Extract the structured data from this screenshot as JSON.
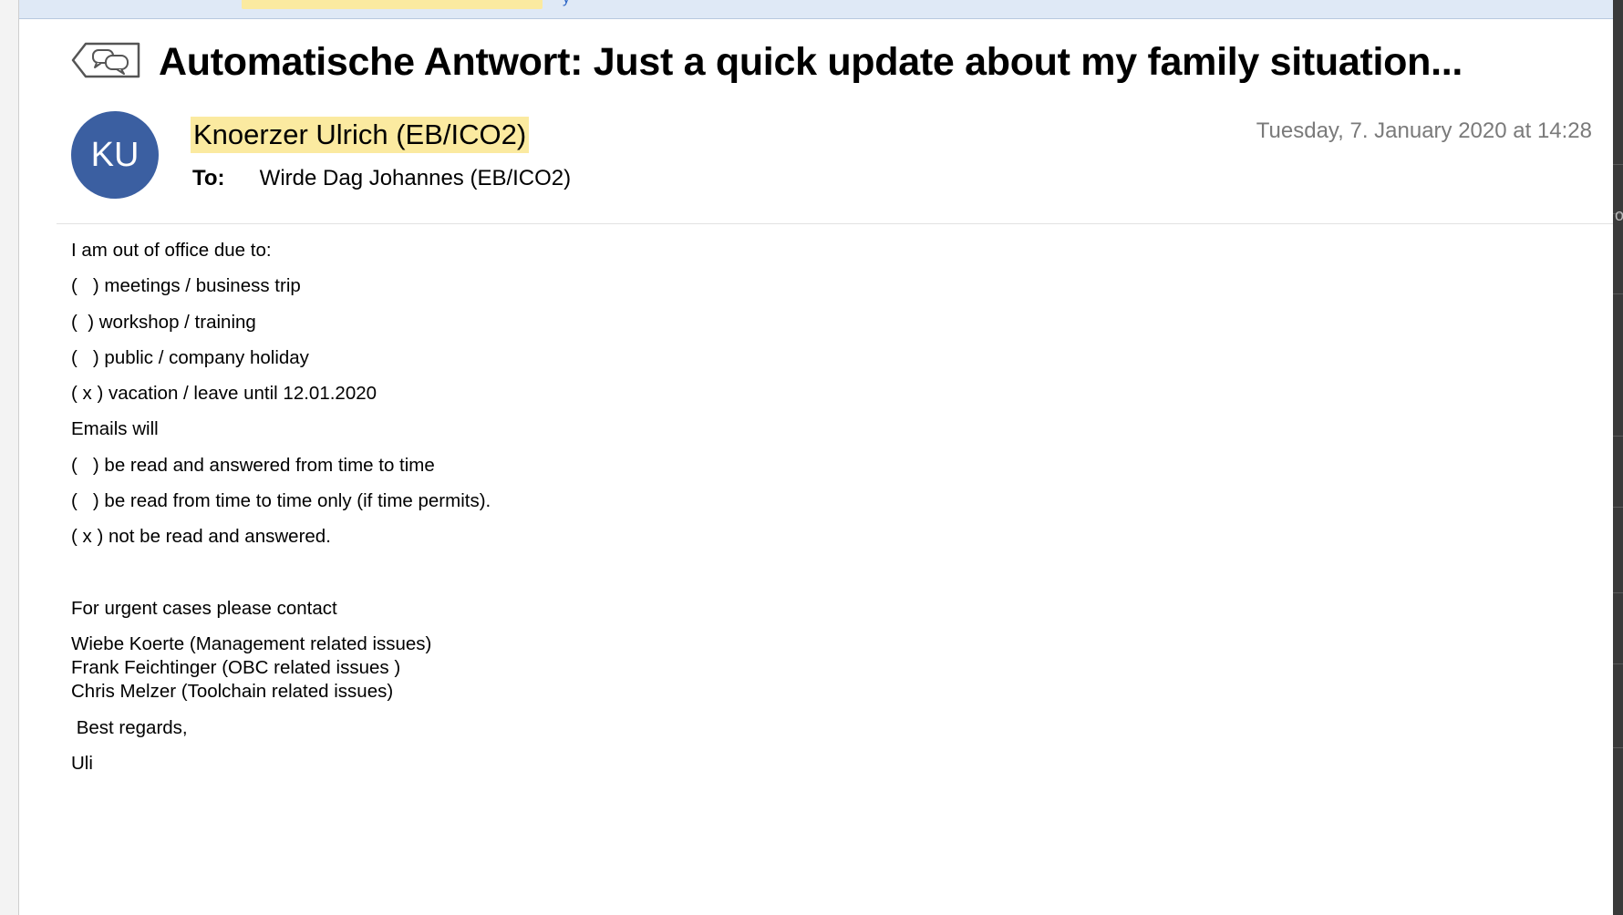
{
  "window": {
    "top_strip_text": "y"
  },
  "message": {
    "subject": "Automatische Antwort: Just a quick update about my family situation...",
    "sender_initials": "KU",
    "sender_name": "Knoerzer Ulrich (EB/ICO2)",
    "date": "Tuesday, 7. January 2020 at 14:28",
    "to_label": "To:",
    "to_value": "Wirde Dag Johannes (EB/ICO2)",
    "body": {
      "intro": "I am out of office due to:",
      "opt_meetings": "(   ) meetings / business trip",
      "opt_workshop": "(  ) workshop / training",
      "opt_holiday": "(   ) public / company holiday",
      "opt_vacation": "( x ) vacation / leave until 12.01.2020",
      "emails_will": "Emails will",
      "opt_read_answer": "(   ) be read and answered from time to time",
      "opt_read_only": "(   ) be read from time to time only (if time permits).",
      "opt_not_read": "( x ) not be read and answered.",
      "urgent": "For urgent cases please contact",
      "contacts": [
        "Wiebe Koerte (Management related issues)",
        "Frank Feichtinger (OBC related issues )",
        "Chris Melzer (Toolchain related issues)"
      ],
      "regards": " Best regards,",
      "signature": "Uli"
    }
  },
  "right_strip_text": "or",
  "colors": {
    "avatar_bg": "#3b5fa1",
    "highlight": "#fbeaa0",
    "date_gray": "#7a7a7a"
  },
  "icons": {
    "reply_icon": "speech-bubbles-reply"
  }
}
